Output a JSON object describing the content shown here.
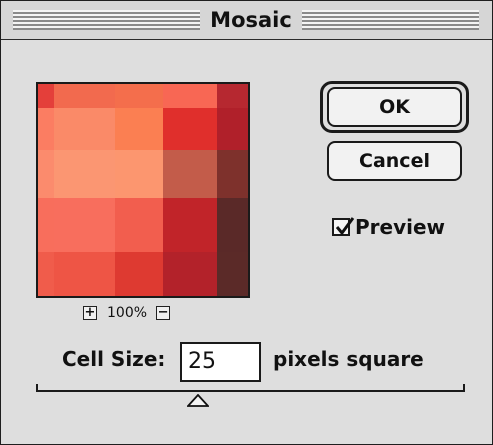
{
  "dialog": {
    "title": "Mosaic",
    "buttons": {
      "ok": "OK",
      "cancel": "Cancel"
    },
    "preview_checkbox": {
      "label": "Preview",
      "checked": true
    },
    "zoom": {
      "level": "100%",
      "zoom_in_glyph": "+",
      "zoom_out_glyph": "−"
    },
    "cell_size": {
      "label": "Cell Size:",
      "value": "25",
      "unit": "pixels square"
    },
    "slider": {
      "value": 25
    }
  },
  "preview_mosaic": {
    "rows": [
      [
        "#e43f3a",
        "#f26a4e",
        "#f46e4c",
        "#f86754",
        "#b62830"
      ],
      [
        "#fb7d62",
        "#fa8a68",
        "#fb7f52",
        "#e02f2c",
        "#b0202a"
      ],
      [
        "#fb8b6d",
        "#fb9672",
        "#fc966f",
        "#c35c4a",
        "#7e312c"
      ],
      [
        "#f86e5c",
        "#f86e5d",
        "#f25e4e",
        "#c12429",
        "#5a2928"
      ],
      [
        "#f05c4b",
        "#ee5545",
        "#de3a31",
        "#b3222a",
        "#5b2a28"
      ]
    ]
  }
}
